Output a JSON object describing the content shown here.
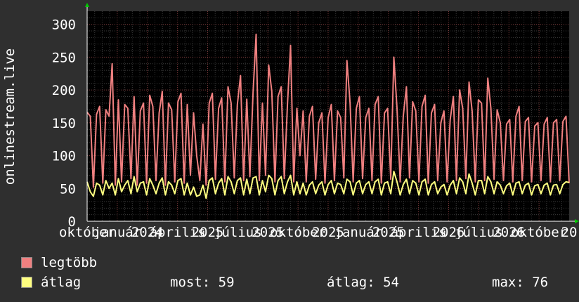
{
  "chart_data": {
    "type": "line",
    "ylabel": "onlinestream.live",
    "ylim": [
      0,
      320
    ],
    "yticks": [
      0,
      50,
      100,
      150,
      200,
      250,
      300
    ],
    "xticks": [
      "október",
      "január",
      "2024",
      "április",
      "2025",
      "július",
      "2025",
      "október",
      "2025",
      "január",
      "2025",
      "április",
      "2026",
      "július",
      "2026",
      "október",
      "20"
    ],
    "grid": true,
    "legend_position": "bottom-left",
    "series": [
      {
        "name": "legtöbb",
        "color": "#f08080",
        "values": [
          166,
          160,
          52,
          163,
          175,
          58,
          170,
          160,
          240,
          55,
          185,
          60,
          178,
          172,
          65,
          190,
          55,
          168,
          180,
          58,
          192,
          175,
          62,
          165,
          198,
          55,
          180,
          170,
          60,
          182,
          195,
          58,
          178,
          70,
          165,
          100,
          62,
          148,
          55,
          180,
          195,
          64,
          172,
          188,
          60,
          205,
          180,
          66,
          178,
          222,
          62,
          186,
          68,
          195,
          285,
          62,
          180,
          70,
          238,
          198,
          60,
          190,
          205,
          65,
          178,
          268,
          60,
          172,
          100,
          168,
          60,
          160,
          175,
          64,
          150,
          165,
          58,
          158,
          178,
          62,
          168,
          158,
          66,
          245,
          180,
          60,
          172,
          190,
          65,
          158,
          172,
          62,
          178,
          190,
          58,
          165,
          172,
          64,
          250,
          172,
          60,
          160,
          205,
          66,
          182,
          168,
          60,
          175,
          192,
          58,
          165,
          178,
          62,
          150,
          168,
          60,
          155,
          190,
          62,
          200,
          172,
          65,
          212,
          168,
          60,
          185,
          180,
          62,
          218,
          172,
          64,
          170,
          150,
          62,
          148,
          155,
          60,
          160,
          175,
          62,
          152,
          158,
          60,
          145,
          150,
          62,
          148,
          158,
          60,
          150,
          155,
          62,
          152,
          160,
          58
        ]
      },
      {
        "name": "átlag",
        "color": "#ffff80",
        "values": [
          60,
          45,
          38,
          58,
          55,
          40,
          62,
          50,
          58,
          40,
          65,
          45,
          55,
          62,
          42,
          68,
          45,
          58,
          60,
          40,
          65,
          55,
          42,
          58,
          66,
          40,
          60,
          55,
          42,
          62,
          65,
          40,
          58,
          40,
          52,
          38,
          40,
          55,
          35,
          62,
          66,
          42,
          58,
          65,
          40,
          68,
          60,
          42,
          62,
          66,
          40,
          64,
          42,
          66,
          68,
          40,
          62,
          45,
          70,
          65,
          40,
          62,
          68,
          42,
          60,
          70,
          40,
          60,
          42,
          58,
          40,
          55,
          60,
          42,
          55,
          60,
          40,
          56,
          62,
          42,
          58,
          56,
          42,
          64,
          60,
          40,
          58,
          62,
          42,
          56,
          60,
          42,
          60,
          64,
          40,
          58,
          60,
          42,
          76,
          60,
          40,
          56,
          64,
          42,
          62,
          58,
          40,
          60,
          64,
          40,
          56,
          60,
          42,
          52,
          56,
          40,
          55,
          62,
          42,
          66,
          60,
          42,
          72,
          58,
          40,
          62,
          62,
          42,
          68,
          60,
          42,
          60,
          55,
          42,
          54,
          58,
          40,
          58,
          60,
          42,
          55,
          58,
          40,
          54,
          56,
          42,
          55,
          58,
          40,
          55,
          56,
          42,
          56,
          60,
          59
        ]
      }
    ]
  },
  "legend": {
    "items": [
      {
        "label": "legtöbb",
        "color": "#f08080"
      },
      {
        "label": "átlag",
        "color": "#ffff80"
      }
    ],
    "stats": {
      "now_label": "most:",
      "now_value": "59",
      "avg_label": "átlag:",
      "avg_value": "54",
      "max_label": "max:",
      "max_value": "76"
    }
  }
}
